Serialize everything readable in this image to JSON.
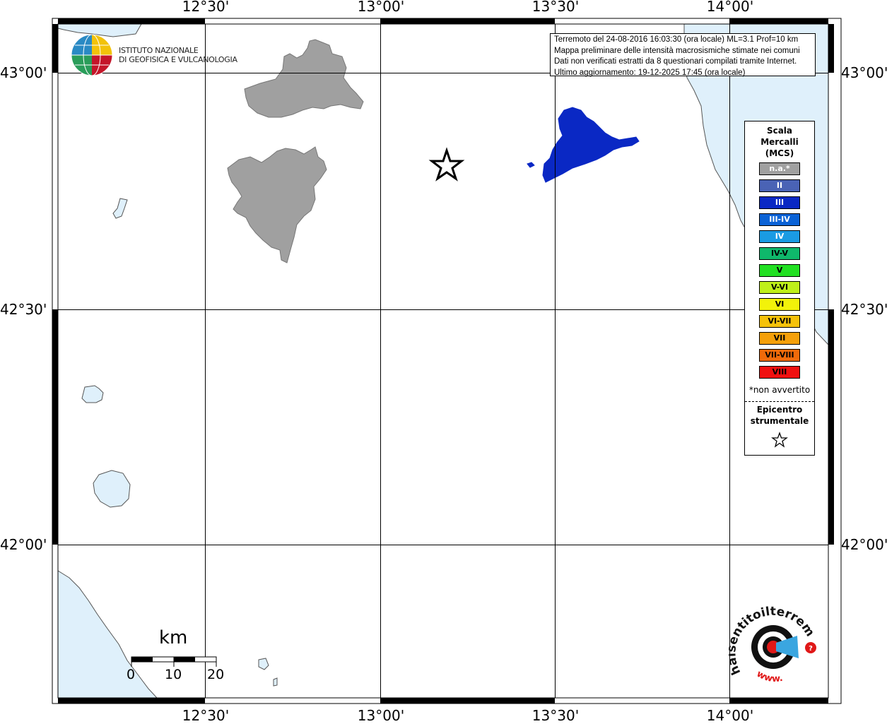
{
  "map": {
    "lon_labels": [
      "12°30'",
      "13°00'",
      "13°30'",
      "14°00'"
    ],
    "lat_labels": [
      "43°00'",
      "42°30'",
      "42°00'"
    ]
  },
  "info": {
    "line1": "Terremoto del 24-08-2016 16:03:30 (ora locale) ML=3.1 Prof=10 km",
    "line2": "Mappa preliminare delle intensità macrosismiche stimate nei comuni",
    "line3": "Dati non verificati estratti da 8 questionari compilati tramite Internet.",
    "line4": "Ultimo aggiornamento: 19-12-2025 17:45 (ora locale)"
  },
  "logo_ingv": {
    "line1": "ISTITUTO NAZIONALE",
    "line2": "DI GEOFISICA E VULCANOLOGIA"
  },
  "legend": {
    "title_1": "Scala",
    "title_2": "Mercalli",
    "title_3": "(MCS)",
    "levels": [
      {
        "label": "n.a.*",
        "color": "#a0a0a0",
        "text_color": "#ffffff"
      },
      {
        "label": "II",
        "color": "#4a63b5",
        "text_color": "#ffffff"
      },
      {
        "label": "III",
        "color": "#0a28c4",
        "text_color": "#ffffff"
      },
      {
        "label": "III-IV",
        "color": "#0a62d6",
        "text_color": "#ffffff"
      },
      {
        "label": "IV",
        "color": "#1a9be3",
        "text_color": "#ffffff"
      },
      {
        "label": "IV-V",
        "color": "#0fb86b",
        "text_color": "#000000"
      },
      {
        "label": "V",
        "color": "#22e022",
        "text_color": "#000000"
      },
      {
        "label": "V-VI",
        "color": "#bff01a",
        "text_color": "#000000"
      },
      {
        "label": "VI",
        "color": "#f2f20a",
        "text_color": "#000000"
      },
      {
        "label": "VI-VII",
        "color": "#f5c20a",
        "text_color": "#000000"
      },
      {
        "label": "VII",
        "color": "#f5a00a",
        "text_color": "#000000"
      },
      {
        "label": "VII-VIII",
        "color": "#f06a0a",
        "text_color": "#000000"
      },
      {
        "label": "VIII",
        "color": "#f01010",
        "text_color": "#000000"
      }
    ],
    "not_felt_note": "*non avvertito",
    "epicenter_1": "Epicentro",
    "epicenter_2": "strumentale"
  },
  "scalebar": {
    "unit": "km",
    "ticks": [
      "0",
      "10",
      "20"
    ]
  },
  "logo_hsit": {
    "text": "haisentitoilterremoto.it",
    "www": "www."
  },
  "colors": {
    "sea": "#dff0fb",
    "area_na": "#a0a0a0",
    "area_iii": "#0a28c4"
  }
}
